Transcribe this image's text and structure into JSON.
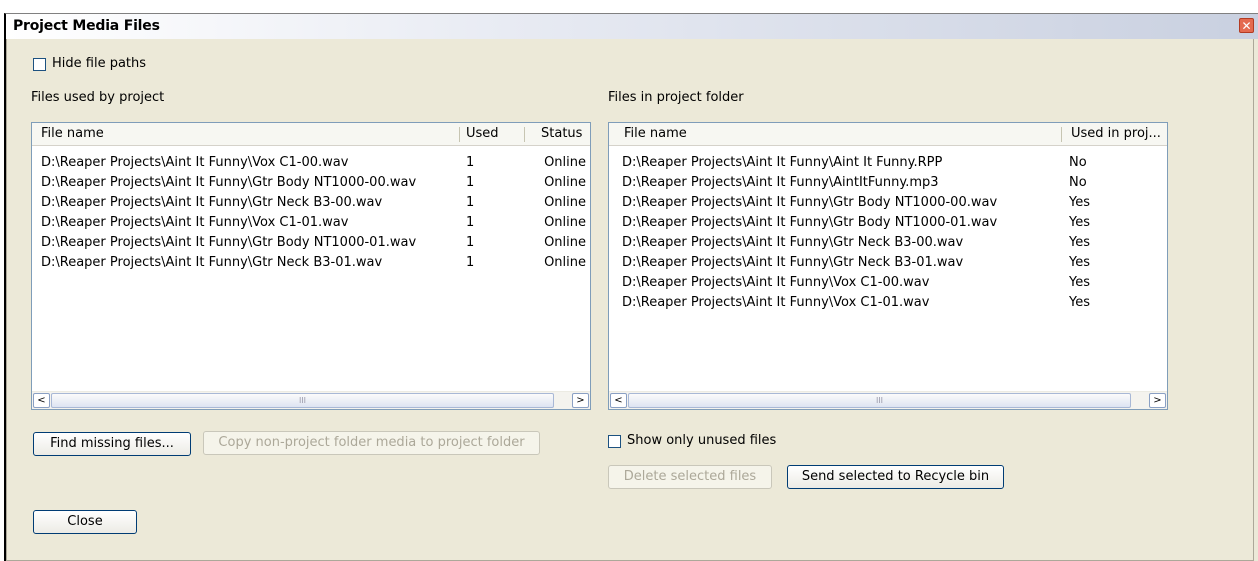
{
  "window": {
    "title": "Project Media Files",
    "close_glyph": "✕"
  },
  "options": {
    "hide_paths": "Hide file paths",
    "show_unused": "Show only unused files"
  },
  "left": {
    "label": "Files used by project",
    "columns": [
      "File name",
      "Used",
      "Status"
    ],
    "rows": [
      [
        "D:\\Reaper Projects\\Aint It Funny\\Vox C1-00.wav",
        "1",
        "Online"
      ],
      [
        "D:\\Reaper Projects\\Aint It Funny\\Gtr Body NT1000-00.wav",
        "1",
        "Online"
      ],
      [
        "D:\\Reaper Projects\\Aint It Funny\\Gtr Neck B3-00.wav",
        "1",
        "Online"
      ],
      [
        "D:\\Reaper Projects\\Aint It Funny\\Vox C1-01.wav",
        "1",
        "Online"
      ],
      [
        "D:\\Reaper Projects\\Aint It Funny\\Gtr Body NT1000-01.wav",
        "1",
        "Online"
      ],
      [
        "D:\\Reaper Projects\\Aint It Funny\\Gtr Neck B3-01.wav",
        "1",
        "Online"
      ]
    ]
  },
  "right": {
    "label": "Files in project folder",
    "columns": [
      "File name",
      "Used in proj..."
    ],
    "rows": [
      [
        "D:\\Reaper Projects\\Aint It Funny\\Aint It Funny.RPP",
        "No"
      ],
      [
        "D:\\Reaper Projects\\Aint It Funny\\AintItFunny.mp3",
        "No"
      ],
      [
        "D:\\Reaper Projects\\Aint It Funny\\Gtr Body NT1000-00.wav",
        "Yes"
      ],
      [
        "D:\\Reaper Projects\\Aint It Funny\\Gtr Body NT1000-01.wav",
        "Yes"
      ],
      [
        "D:\\Reaper Projects\\Aint It Funny\\Gtr Neck B3-00.wav",
        "Yes"
      ],
      [
        "D:\\Reaper Projects\\Aint It Funny\\Gtr Neck B3-01.wav",
        "Yes"
      ],
      [
        "D:\\Reaper Projects\\Aint It Funny\\Vox C1-00.wav",
        "Yes"
      ],
      [
        "D:\\Reaper Projects\\Aint It Funny\\Vox C1-01.wav",
        "Yes"
      ]
    ]
  },
  "scroll": {
    "left_arrow": "<",
    "right_arrow": ">",
    "grip": "III"
  },
  "buttons": {
    "find_missing": "Find missing files...",
    "copy_media": "Copy non-project folder media to project folder",
    "delete_selected": "Delete selected files",
    "send_recycle": "Send selected to Recycle bin",
    "close": "Close"
  }
}
